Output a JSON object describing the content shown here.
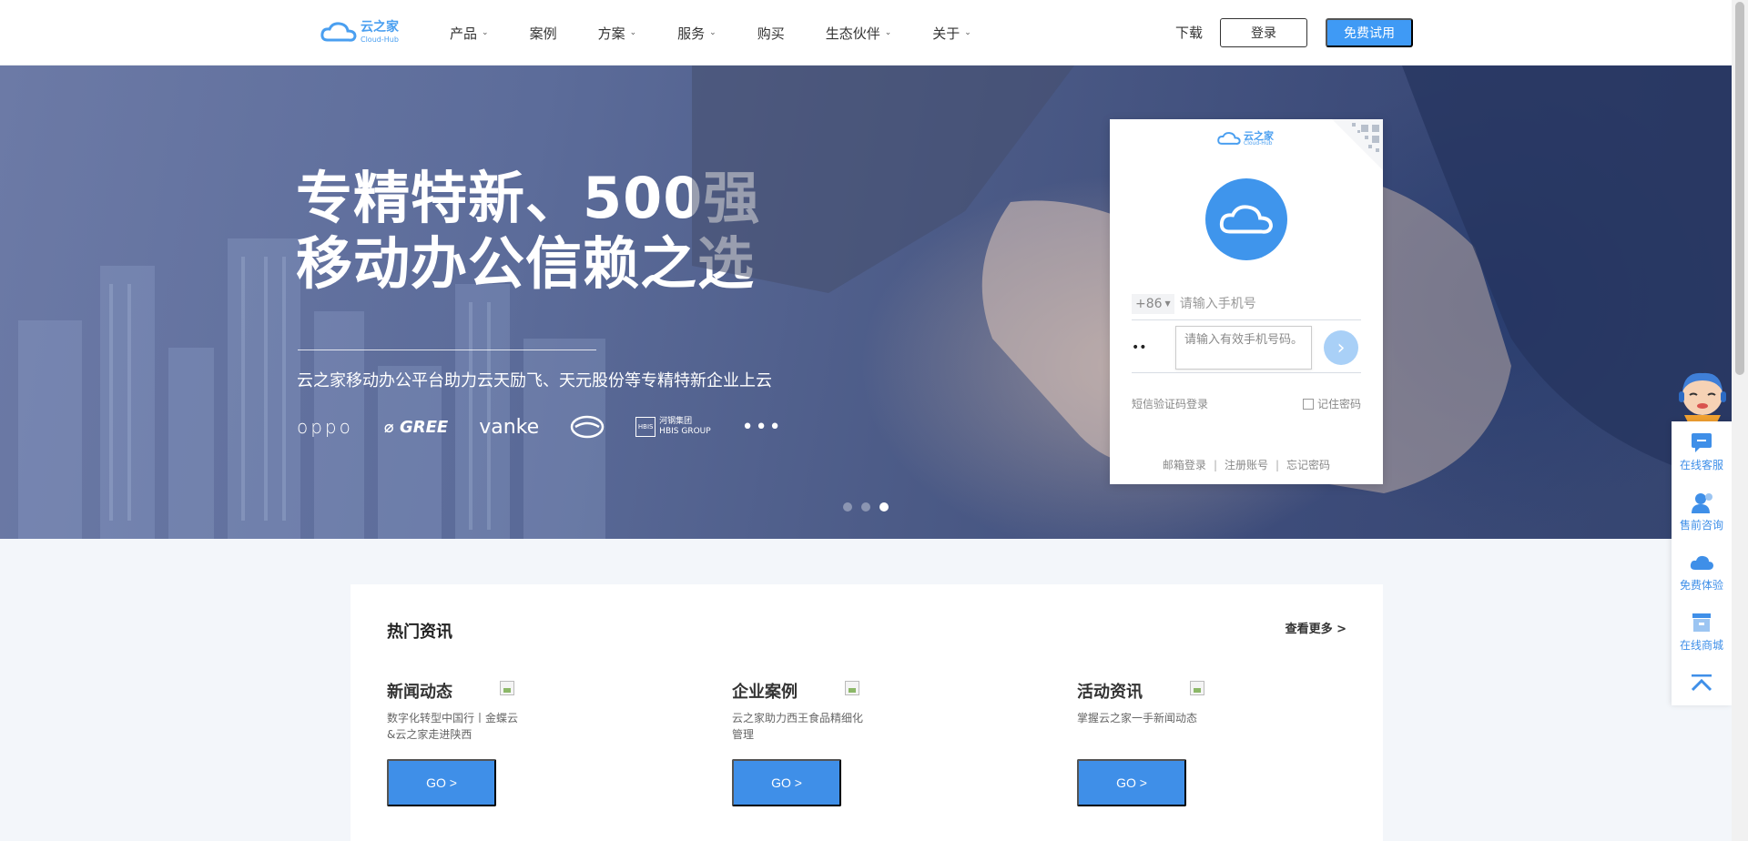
{
  "header": {
    "logo": {
      "name": "云之家",
      "sub": "Cloud-Hub"
    },
    "nav": [
      {
        "label": "产品",
        "dropdown": true
      },
      {
        "label": "案例",
        "dropdown": false
      },
      {
        "label": "方案",
        "dropdown": true
      },
      {
        "label": "服务",
        "dropdown": true
      },
      {
        "label": "购买",
        "dropdown": false
      },
      {
        "label": "生态伙伴",
        "dropdown": true
      },
      {
        "label": "关于",
        "dropdown": true
      }
    ],
    "download": "下载",
    "login": "登录",
    "trial": "免费试用"
  },
  "hero": {
    "title_line1": "专精特新、500强",
    "title_line2": "移动办公信赖之选",
    "subtitle": "云之家移动办公平台助力云天励飞、天元股份等专精特新企业上云",
    "partners": [
      "oppo",
      "GREE",
      "vanke",
      "HBIS",
      "HBIS GROUP",
      "河钢集团",
      "•••"
    ],
    "slide_count": 3,
    "active_slide": 3
  },
  "login_card": {
    "logo_name": "云之家",
    "logo_sub": "Cloud-Hub",
    "country_code": "+86",
    "phone_placeholder": "请输入手机号",
    "password_mask": "••",
    "tooltip": "请输入有效手机号码。",
    "sms_login": "短信验证码登录",
    "remember": "记住密码",
    "links": [
      "邮箱登录",
      "注册账号",
      "忘记密码"
    ]
  },
  "news": {
    "title": "热门资讯",
    "more": "查看更多 >",
    "columns": [
      {
        "title": "新闻动态",
        "desc": "数字化转型中国行丨金蝶云&云之家走进陕西",
        "go": "GO >"
      },
      {
        "title": "企业案例",
        "desc": "云之家助力西王食品精细化管理",
        "go": "GO >"
      },
      {
        "title": "活动资讯",
        "desc": "掌握云之家一手新闻动态",
        "go": "GO >"
      }
    ]
  },
  "sidebar": {
    "items": [
      "在线客服",
      "售前咨询",
      "免费体验",
      "在线商城"
    ]
  },
  "colors": {
    "brand_blue": "#3f9af5",
    "button_blue": "#3f8fe8",
    "hero_bg": "#4b5a86"
  }
}
